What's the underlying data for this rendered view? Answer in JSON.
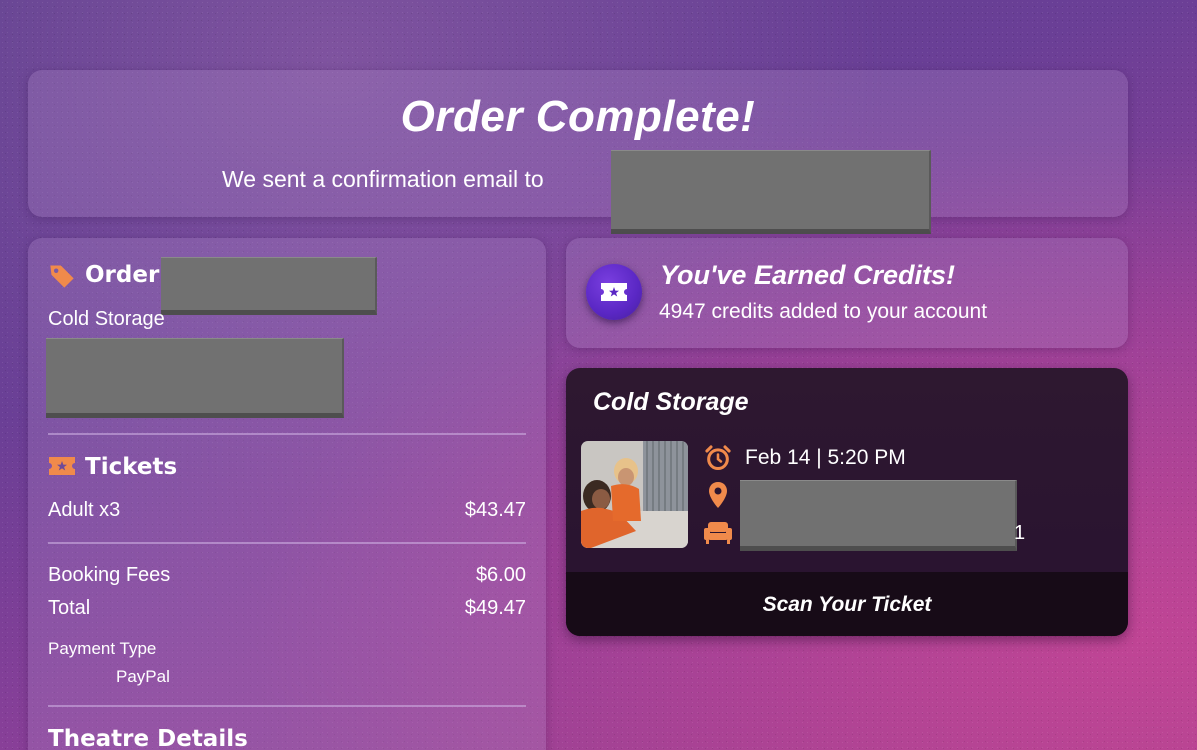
{
  "header": {
    "title": "Order Complete!",
    "email_prefix": "We sent a confirmation email to"
  },
  "order": {
    "heading": "Order",
    "movie": "Cold Storage",
    "tickets_heading": "Tickets",
    "ticket_line": {
      "label": "Adult x3",
      "amount": "$43.47"
    },
    "fees": {
      "label": "Booking Fees",
      "amount": "$6.00"
    },
    "total": {
      "label": "Total",
      "amount": "$49.47"
    },
    "payment_type_label": "Payment Type",
    "payment_type_value": "PayPal",
    "theatre_heading": "Theatre Details"
  },
  "credits": {
    "title": "You've Earned Credits!",
    "subtitle": "4947 credits added to your account"
  },
  "ticket": {
    "movie": "Cold Storage",
    "datetime": "Feb 14 | 5:20 PM",
    "trailing_char": "1",
    "scan_label": "Scan Your Ticket"
  },
  "icons": {
    "tag": "tag-icon",
    "ticket": "ticket-icon",
    "alarm": "alarm-clock-icon",
    "location": "location-pin-icon",
    "seat": "seat-sofa-icon"
  },
  "colors": {
    "accent_orange": "#f08a4b",
    "credit_badge": "#5a27c4",
    "ticket_card_bg": "#2e1830",
    "scan_bar_bg": "#170b17"
  }
}
